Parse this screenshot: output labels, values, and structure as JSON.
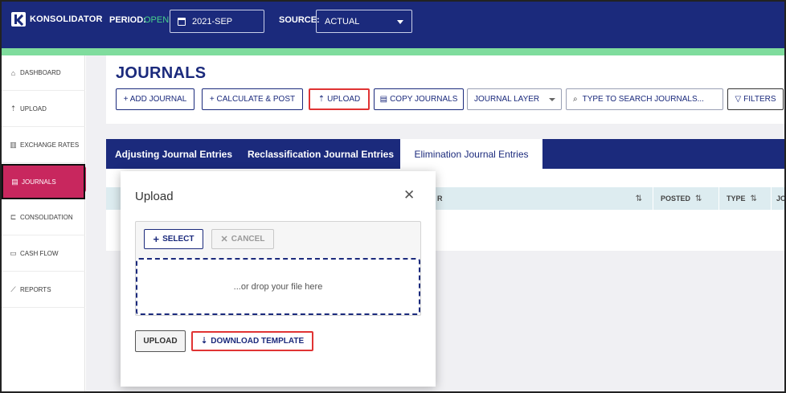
{
  "app": {
    "name": "KONSOLIDATOR"
  },
  "topbar": {
    "period_label": "PERIOD:",
    "period_status": "OPEN",
    "period_value": "2021-SEP",
    "source_label": "SOURCE:",
    "source_value": "ACTUAL"
  },
  "sidebar": {
    "items": [
      {
        "label": "DASHBOARD",
        "icon": "home-icon"
      },
      {
        "label": "UPLOAD",
        "icon": "upload-icon"
      },
      {
        "label": "EXCHANGE RATES",
        "icon": "bar-chart-icon"
      },
      {
        "label": "JOURNALS",
        "icon": "document-icon",
        "active": true
      },
      {
        "label": "CONSOLIDATION",
        "icon": "konsolidator-icon"
      },
      {
        "label": "CASH FLOW",
        "icon": "cash-icon"
      },
      {
        "label": "REPORTS",
        "icon": "line-chart-icon"
      }
    ]
  },
  "page": {
    "title": "JOURNALS",
    "toolbar": {
      "add_journal": "+ ADD JOURNAL",
      "calculate_post": "+ CALCULATE & POST",
      "upload": "UPLOAD",
      "copy_journals": "COPY JOURNALS",
      "journal_layer": "JOURNAL LAYER",
      "search_placeholder": "TYPE TO SEARCH JOURNALS...",
      "filters": "FILTERS"
    },
    "tabs": [
      {
        "label": "Adjusting Journal Entries"
      },
      {
        "label": "Reclassification Journal Entries"
      },
      {
        "label": "Elimination Journal Entries",
        "active": true
      }
    ],
    "table": {
      "columns": [
        "R",
        "POSTED",
        "TYPE",
        "JO"
      ],
      "sort_glyph": "⇅"
    }
  },
  "modal": {
    "title": "Upload",
    "select_label": "SELECT",
    "cancel_label": "CANCEL",
    "drop_text": "...or drop your file here",
    "upload_label": "UPLOAD",
    "download_template_label": "DOWNLOAD TEMPLATE"
  },
  "colors": {
    "navy": "#1b2a7c",
    "green_accent": "#7fdc9d",
    "active_pink": "#c8275e",
    "highlight_red": "#e03434"
  }
}
